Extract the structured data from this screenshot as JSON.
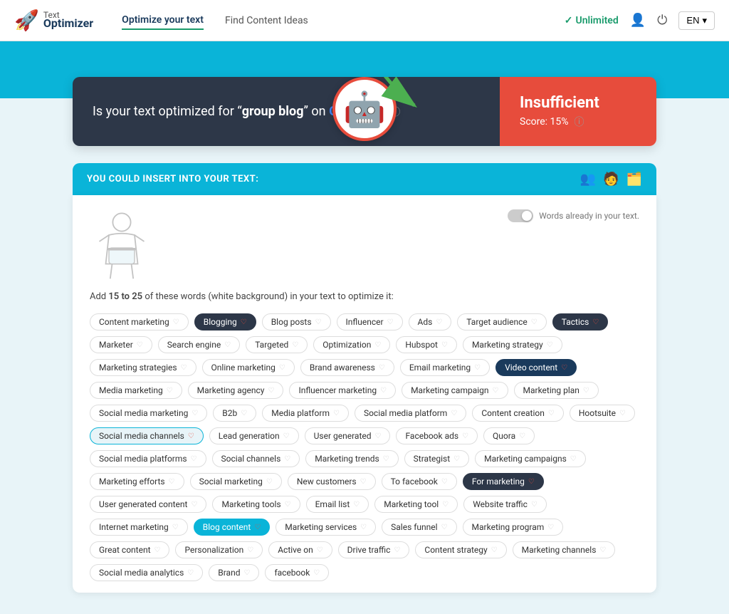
{
  "header": {
    "logo_line1": "Text",
    "logo_line2": "Optimizer",
    "nav": {
      "optimize": "Optimize your text",
      "find_content": "Find Content Ideas",
      "unlimited": "Unlimited",
      "lang": "EN"
    }
  },
  "score_card": {
    "question_prefix": "Is your text optimized for “",
    "keyword": "group blog",
    "question_suffix": "” on ",
    "google": "Google™?",
    "label_insufficient": "Insufficient",
    "score_label": "Score: 15%"
  },
  "insert_section": {
    "title": "YOU COULD INSERT INTO YOUR TEXT:",
    "toggle_label": "Words already in your text."
  },
  "instruction": {
    "prefix": "Add ",
    "range": "15 to 25",
    "suffix": " of these words (white background) in your text to optimize it:"
  },
  "tags": [
    {
      "label": "Content marketing",
      "style": "normal"
    },
    {
      "label": "Blogging",
      "style": "highlight"
    },
    {
      "label": "Blog posts",
      "style": "normal"
    },
    {
      "label": "Influencer",
      "style": "normal"
    },
    {
      "label": "Ads",
      "style": "normal"
    },
    {
      "label": "Target audience",
      "style": "normal"
    },
    {
      "label": "Tactics",
      "style": "highlight"
    },
    {
      "label": "Marketer",
      "style": "normal"
    },
    {
      "label": "Search engine",
      "style": "normal"
    },
    {
      "label": "Targeted",
      "style": "normal"
    },
    {
      "label": "Optimization",
      "style": "normal"
    },
    {
      "label": "Hubspot",
      "style": "normal"
    },
    {
      "label": "Marketing strategy",
      "style": "normal"
    },
    {
      "label": "Marketing strategies",
      "style": "normal"
    },
    {
      "label": "Online marketing",
      "style": "normal"
    },
    {
      "label": "Brand awareness",
      "style": "normal"
    },
    {
      "label": "Email marketing",
      "style": "normal"
    },
    {
      "label": "Video content",
      "style": "video"
    },
    {
      "label": "Media marketing",
      "style": "normal"
    },
    {
      "label": "Marketing agency",
      "style": "normal"
    },
    {
      "label": "Influencer marketing",
      "style": "normal"
    },
    {
      "label": "Marketing campaign",
      "style": "normal"
    },
    {
      "label": "Marketing plan",
      "style": "normal"
    },
    {
      "label": "Social media marketing",
      "style": "normal"
    },
    {
      "label": "B2b",
      "style": "normal"
    },
    {
      "label": "Media platform",
      "style": "normal"
    },
    {
      "label": "Social media platform",
      "style": "normal"
    },
    {
      "label": "Content creation",
      "style": "normal"
    },
    {
      "label": "Hootsuite",
      "style": "normal"
    },
    {
      "label": "Social media channels",
      "style": "highlight3"
    },
    {
      "label": "Lead generation",
      "style": "normal"
    },
    {
      "label": "User generated",
      "style": "normal"
    },
    {
      "label": "Facebook ads",
      "style": "normal"
    },
    {
      "label": "Quora",
      "style": "normal"
    },
    {
      "label": "Social media platforms",
      "style": "normal"
    },
    {
      "label": "Social channels",
      "style": "normal"
    },
    {
      "label": "Marketing trends",
      "style": "normal"
    },
    {
      "label": "Strategist",
      "style": "normal"
    },
    {
      "label": "Marketing campaigns",
      "style": "normal"
    },
    {
      "label": "Marketing efforts",
      "style": "normal"
    },
    {
      "label": "Social marketing",
      "style": "normal"
    },
    {
      "label": "New customers",
      "style": "normal"
    },
    {
      "label": "To facebook",
      "style": "normal"
    },
    {
      "label": "For marketing",
      "style": "for-marketing"
    },
    {
      "label": "User generated content",
      "style": "normal"
    },
    {
      "label": "Marketing tools",
      "style": "normal"
    },
    {
      "label": "Email list",
      "style": "normal"
    },
    {
      "label": "Marketing tool",
      "style": "normal"
    },
    {
      "label": "Website traffic",
      "style": "normal"
    },
    {
      "label": "Internet marketing",
      "style": "normal"
    },
    {
      "label": "Blog content",
      "style": "blog-content"
    },
    {
      "label": "Marketing services",
      "style": "normal"
    },
    {
      "label": "Sales funnel",
      "style": "normal"
    },
    {
      "label": "Marketing program",
      "style": "normal"
    },
    {
      "label": "Great content",
      "style": "normal"
    },
    {
      "label": "Personalization",
      "style": "normal"
    },
    {
      "label": "Active on",
      "style": "normal"
    },
    {
      "label": "Drive traffic",
      "style": "normal"
    },
    {
      "label": "Content strategy",
      "style": "normal"
    },
    {
      "label": "Marketing channels",
      "style": "normal"
    },
    {
      "label": "Social media analytics",
      "style": "normal"
    },
    {
      "label": "Brand",
      "style": "normal"
    },
    {
      "label": "facebook",
      "style": "normal"
    },
    {
      "label": "Marketing tool",
      "style": "normal"
    },
    {
      "label": "Social marketing",
      "style": "normal"
    },
    {
      "label": "Marketing tools",
      "style": "normal"
    }
  ]
}
